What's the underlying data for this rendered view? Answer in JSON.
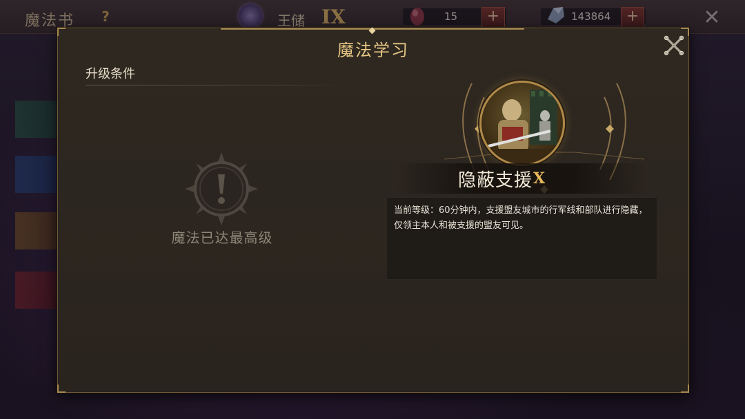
{
  "topbar": {
    "title": "魔法书",
    "help_glyph": "?",
    "rank_label": "王储",
    "rank_numeral": "IX",
    "gems_value": "15",
    "resource_value": "143864",
    "plus_glyph": "+",
    "close_glyph": "✕"
  },
  "modal": {
    "title": "魔法学习",
    "section_title": "升级条件",
    "max_level_text": "魔法已达最高级",
    "spell": {
      "name": "隐蔽支援",
      "level": "X",
      "description": "当前等级：60分钟内，支援盟友城市的行军线和部队进行隐藏，仅领主本人和被支援的盟友可见。"
    }
  },
  "colors": {
    "accent_gold": "#e8c884",
    "frame_gold": "#a88a52",
    "panel_bg": "#2a241e",
    "muted_text": "#8e8678"
  },
  "icons": {
    "close": "close-x-icon",
    "warning": "exclamation-sun-icon",
    "help": "question-icon"
  }
}
